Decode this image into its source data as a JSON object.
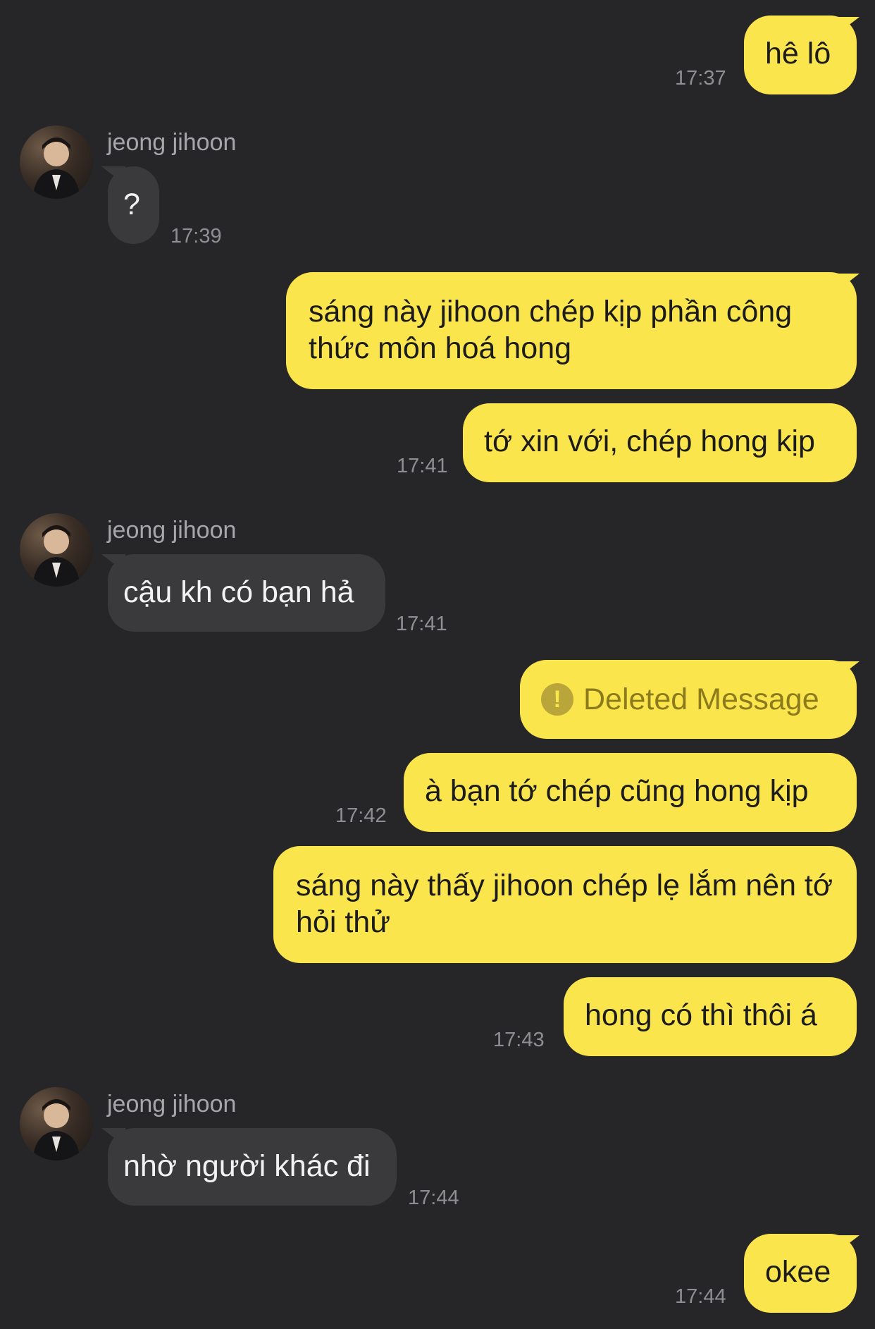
{
  "contact": {
    "name": "jeong jihoon"
  },
  "deleted_label": "Deleted Message",
  "messages": [
    {
      "text": "hê lô",
      "time": "17:37"
    },
    {
      "text": "?",
      "time": "17:39"
    },
    {
      "text": "sáng này jihoon chép kịp phần công thức môn hoá hong"
    },
    {
      "text": "tớ xin với, chép hong kịp",
      "time": "17:41"
    },
    {
      "text": "cậu kh có bạn hả",
      "time": "17:41"
    },
    {
      "text": "à bạn tớ chép cũng hong kịp",
      "time": "17:42"
    },
    {
      "text": "sáng này thấy jihoon chép lẹ lắm nên tớ hỏi thử"
    },
    {
      "text": "hong có thì thôi á",
      "time": "17:43"
    },
    {
      "text": "nhờ người khác đi",
      "time": "17:44"
    },
    {
      "text": "okee",
      "time": "17:44"
    }
  ]
}
